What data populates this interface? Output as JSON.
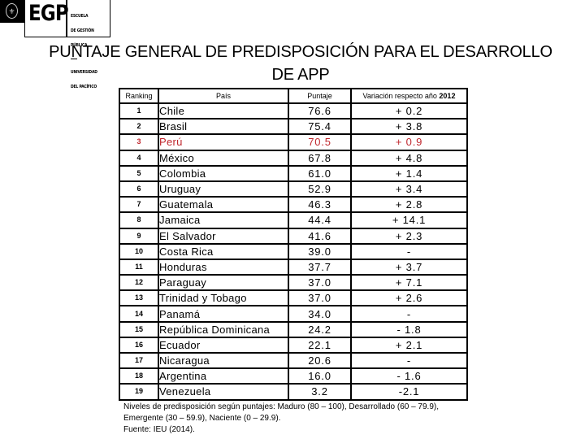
{
  "logo": {
    "emblem_icon": "university-crest-icon",
    "acronym": "EGP",
    "school_lines": [
      "ESCUELA",
      "DE GESTIÓN",
      "PÚBLICA"
    ],
    "university_lines": [
      "UNIVERSIDAD",
      "DEL PACÍFICO"
    ]
  },
  "title": {
    "line1": "PUNTAJE GENERAL DE PREDISPOSICIÓN PARA EL DESARROLLO",
    "line2": "DE APP"
  },
  "table": {
    "headers": {
      "ranking": "Ranking",
      "country": "País",
      "score": "Puntaje",
      "variation_prefix": "Variación respecto año ",
      "variation_year": "2012"
    },
    "highlight_color": "#c0272d",
    "rows": [
      {
        "rank": "1",
        "country": "Chile",
        "score": "76.6",
        "variation": "+ 0.2",
        "highlight": false
      },
      {
        "rank": "2",
        "country": "Brasil",
        "score": "75.4",
        "variation": "+ 3.8",
        "highlight": false
      },
      {
        "rank": "3",
        "country": "Perú",
        "score": "70.5",
        "variation": "+ 0.9",
        "highlight": true
      },
      {
        "rank": "4",
        "country": "México",
        "score": "67.8",
        "variation": "+ 4.8",
        "highlight": false
      },
      {
        "rank": "5",
        "country": "Colombia",
        "score": "61.0",
        "variation": "+ 1.4",
        "highlight": false
      },
      {
        "rank": "6",
        "country": "Uruguay",
        "score": "52.9",
        "variation": "+ 3.4",
        "highlight": false
      },
      {
        "rank": "7",
        "country": "Guatemala",
        "score": "46.3",
        "variation": "+ 2.8",
        "highlight": false
      },
      {
        "rank": "8",
        "country": "Jamaica",
        "score": "44.4",
        "variation": "+ 14.1",
        "highlight": false
      },
      {
        "rank": "9",
        "country": "El Salvador",
        "score": "41.6",
        "variation": "+ 2.3",
        "highlight": false
      },
      {
        "rank": "10",
        "country": "Costa Rica",
        "score": "39.0",
        "variation": "-",
        "highlight": false
      },
      {
        "rank": "11",
        "country": "Honduras",
        "score": "37.7",
        "variation": "+ 3.7",
        "highlight": false
      },
      {
        "rank": "12",
        "country": "Paraguay",
        "score": "37.0",
        "variation": "+ 7.1",
        "highlight": false
      },
      {
        "rank": "13",
        "country": "Trinidad y Tobago",
        "score": "37.0",
        "variation": "+ 2.6",
        "highlight": false
      },
      {
        "rank": "14",
        "country": "Panamá",
        "score": "34.0",
        "variation": "-",
        "highlight": false
      },
      {
        "rank": "15",
        "country": "República Dominicana",
        "score": "24.2",
        "variation": "- 1.8",
        "highlight": false
      },
      {
        "rank": "16",
        "country": "Ecuador",
        "score": "22.1",
        "variation": "+ 2.1",
        "highlight": false
      },
      {
        "rank": "17",
        "country": "Nicaragua",
        "score": "20.6",
        "variation": "-",
        "highlight": false
      },
      {
        "rank": "18",
        "country": "Argentina",
        "score": "16.0",
        "variation": "- 1.6",
        "highlight": false
      },
      {
        "rank": "19",
        "country": "Venezuela",
        "score": "3.2",
        "variation": "-2.1",
        "highlight": false
      }
    ]
  },
  "footnote": {
    "line1": "Niveles de predisposición según puntajes: Maduro (80 – 100), Desarrollado (60 – 79.9),",
    "line2": "Emergente (30 – 59.9), Naciente (0 – 29.9).",
    "source": "Fuente: IEU (2014)."
  }
}
